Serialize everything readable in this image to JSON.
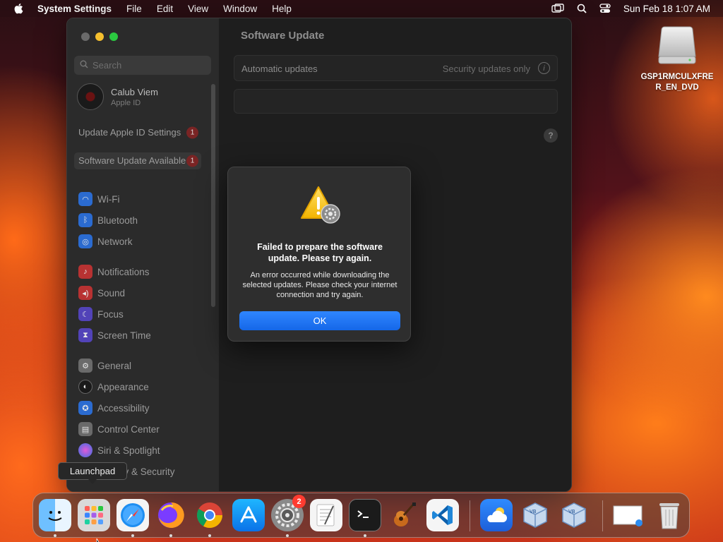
{
  "menubar": {
    "app_name": "System Settings",
    "items": [
      "File",
      "Edit",
      "View",
      "Window",
      "Help"
    ],
    "clock": "Sun Feb 18  1:07 AM"
  },
  "desktop": {
    "drive_label": "GSP1RMCULXFRE R_EN_DVD"
  },
  "window": {
    "search_placeholder": "Search",
    "account": {
      "name": "Calub Viem",
      "sub": "Apple ID"
    },
    "notices": [
      {
        "label": "Update Apple ID Settings",
        "badge": "1"
      },
      {
        "label": "Software Update Available",
        "badge": "1"
      }
    ],
    "nav_groups": [
      [
        {
          "label": "Wi-Fi",
          "icon": "wifi-icon",
          "color": "#2b6bd0"
        },
        {
          "label": "Bluetooth",
          "icon": "bluetooth-icon",
          "color": "#2b6bd0"
        },
        {
          "label": "Network",
          "icon": "globe-icon",
          "color": "#2b6bd0"
        }
      ],
      [
        {
          "label": "Notifications",
          "icon": "bell-icon",
          "color": "#d93a3a"
        },
        {
          "label": "Sound",
          "icon": "speaker-icon",
          "color": "#d93a3a"
        },
        {
          "label": "Focus",
          "icon": "moon-icon",
          "color": "#5a4ad0"
        },
        {
          "label": "Screen Time",
          "icon": "hourglass-icon",
          "color": "#5a4ad0"
        }
      ],
      [
        {
          "label": "General",
          "icon": "gear-icon",
          "color": "#7a7a7a"
        },
        {
          "label": "Appearance",
          "icon": "appearance-icon",
          "color": "#222222"
        },
        {
          "label": "Accessibility",
          "icon": "accessibility-icon",
          "color": "#2b6bd0"
        },
        {
          "label": "Control Center",
          "icon": "control-center-icon",
          "color": "#7a7a7a"
        },
        {
          "label": "Siri & Spotlight",
          "icon": "siri-icon",
          "color": "#9b3ad0"
        },
        {
          "label": "Privacy & Security",
          "icon": "hand-icon",
          "color": "#2b6bd0"
        }
      ]
    ],
    "content": {
      "title": "Software Update",
      "automatic_updates_label": "Automatic updates",
      "automatic_updates_value": "Security updates only",
      "help": "?"
    }
  },
  "alert": {
    "title": "Failed to prepare the software update. Please try again.",
    "message": "An error occurred while downloading the selected updates. Please check your internet connection and try again.",
    "ok_label": "OK"
  },
  "tooltip": "Launchpad",
  "dock": {
    "settings_badge": "2"
  }
}
